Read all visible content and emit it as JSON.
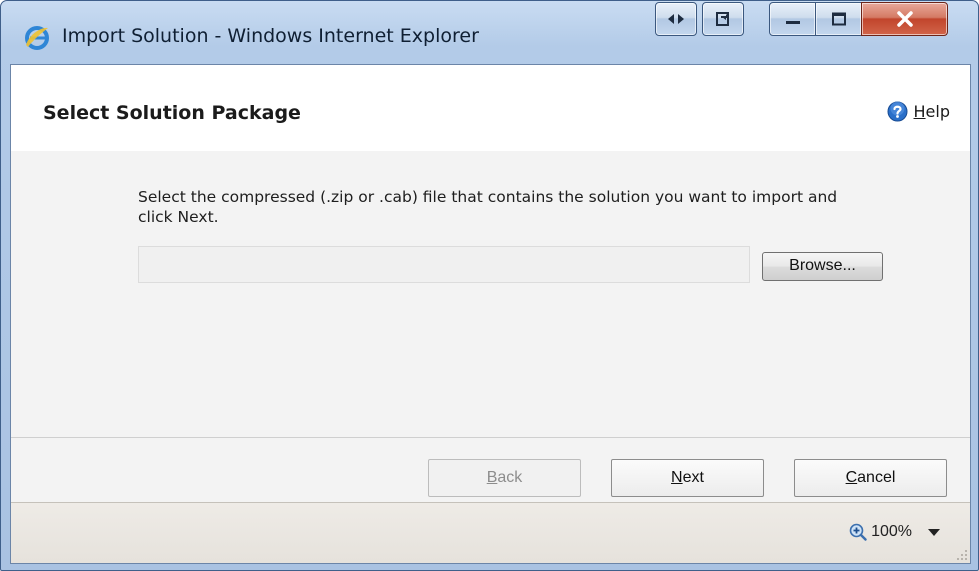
{
  "window": {
    "title": "Import Solution - Windows Internet Explorer"
  },
  "dialog": {
    "title": "Select Solution Package",
    "help_label_first": "H",
    "help_label_rest": "elp",
    "instruction": "Select the compressed (.zip or .cab) file that contains the solution you want to import and click Next.",
    "file_value": "",
    "browse_label": "Browse..."
  },
  "footer": {
    "back_first": "B",
    "back_rest": "ack",
    "next_first": "N",
    "next_rest": "ext",
    "cancel_first": "C",
    "cancel_rest": "ancel"
  },
  "statusbar": {
    "zoom": "100%"
  },
  "icons": {
    "browser": "internet-explorer-icon",
    "help": "help-icon",
    "zoom": "zoom-icon"
  },
  "colors": {
    "titlebar": "#b3cbe8",
    "close_button": "#c1452c",
    "help_icon": "#2a6fc9",
    "body_background": "#f3f3f3"
  }
}
